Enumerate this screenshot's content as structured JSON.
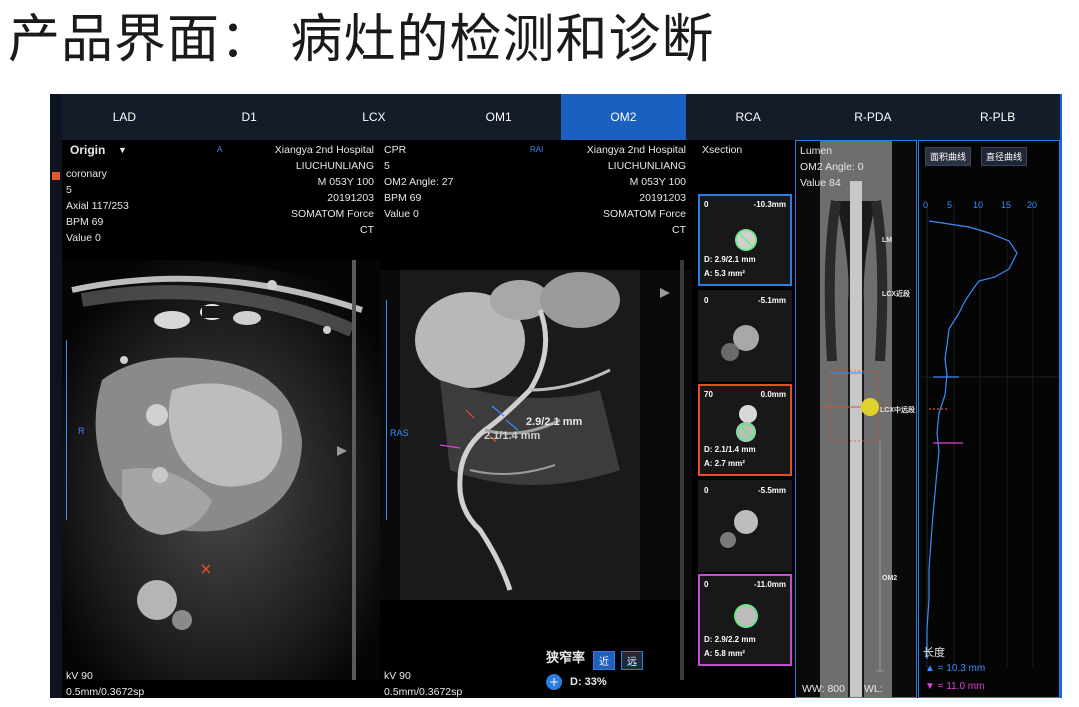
{
  "slide": {
    "title": "产品界面：  病灶的检测和诊断"
  },
  "tabs": [
    "LAD",
    "D1",
    "LCX",
    "OM1",
    "OM2",
    "RCA",
    "R-PDA",
    "R-PLB"
  ],
  "active_tab": "OM2",
  "axial": {
    "title": "Origin",
    "orient_top": "A",
    "orient_left": "R",
    "info_left": [
      "coronary",
      "5",
      "Axial 117/253",
      "BPM 69",
      "Value 0"
    ],
    "info_right": [
      "Xiangya 2nd Hospital",
      "LIUCHUNLIANG",
      "M 053Y 100",
      "20191203",
      "SOMATOM Force",
      "CT"
    ],
    "footer": [
      "kV 90",
      "0.5mm/0.3672sp"
    ]
  },
  "cpr": {
    "title": "CPR",
    "orient_top": "RAI",
    "orient_left": "RAS",
    "info_left": [
      "5",
      "OM2 Angle: 27",
      "BPM 69",
      "Value 0"
    ],
    "info_right": [
      "Xiangya 2nd Hospital",
      "LIUCHUNLIANG",
      "M 053Y 100",
      "20191203",
      "SOMATOM Force",
      "CT"
    ],
    "measure_1": "2.9/2.1 mm",
    "measure_2": "2.1/1.4 mm",
    "footer": [
      "kV 90",
      "0.5mm/0.3672sp"
    ],
    "stenosis_label": "狭窄率",
    "near_label": "近",
    "far_label": "远",
    "stenosis_value": "D: 33%"
  },
  "xsection": {
    "title": "Xsection",
    "boxes": [
      {
        "idx": "0",
        "pos": "-10.3mm",
        "d": "D: 2.9/2.1 mm",
        "a": "A: 5.3 mm²",
        "style": "blue"
      },
      {
        "idx": "0",
        "pos": "-5.1mm",
        "d": "",
        "a": "",
        "style": "none"
      },
      {
        "idx": "70",
        "pos": "0.0mm",
        "d": "D: 2.1/1.4 mm",
        "a": "A: 2.7 mm²",
        "style": "red"
      },
      {
        "idx": "0",
        "pos": "-5.5mm",
        "d": "",
        "a": "",
        "style": "none"
      },
      {
        "idx": "0",
        "pos": "-11.0mm",
        "d": "D: 2.9/2.2 mm",
        "a": "A: 5.8 mm²",
        "style": "purple"
      }
    ]
  },
  "lumen": {
    "info": [
      "Lumen",
      "OM2 Angle: 0",
      "Value 84"
    ],
    "labels": [
      "LM",
      "LCX近段",
      "LCX中远段",
      "OM2"
    ],
    "ww": "WW: 800",
    "wl": "WL:"
  },
  "curve": {
    "btn_area": "面积曲线",
    "btn_diam": "直径曲线",
    "ticks": [
      "0",
      "5",
      "10",
      "15",
      "20"
    ],
    "length_label": "长度",
    "up_marker": "▲ = 10.3 mm",
    "down_marker": "▼ = 11.0 mm"
  },
  "colors": {
    "accent": "#1b5fc1",
    "tabbar": "#141b29",
    "red_box": "#e0502a",
    "purple_box": "#c84ad8",
    "curve": "#3a8cff",
    "magenta": "#e040e0"
  }
}
